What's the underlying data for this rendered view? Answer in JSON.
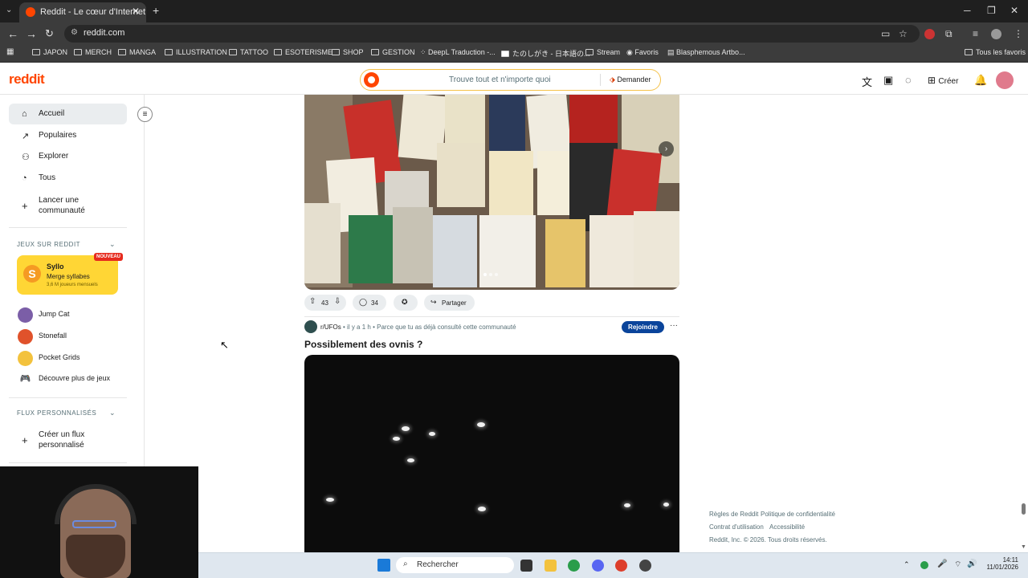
{
  "browser": {
    "tab_title": "Reddit - Le cœur d'Internet",
    "url": "reddit.com",
    "bookmarks": [
      "JAPON",
      "MERCH",
      "MANGA",
      "ILLUSTRATION",
      "TATTOO",
      "ESOTERISME",
      "SHOP",
      "GESTION",
      "DeepL Traduction -...",
      "たのしがき - 日本語の...",
      "Stream",
      "Favoris",
      "Blasphemous Artbo...",
      "Tous les favoris"
    ]
  },
  "header": {
    "logo": "reddit",
    "search_placeholder": "Trouve tout et n'importe quoi",
    "ask_label": "Demander",
    "create_label": "Créer"
  },
  "sidebar": {
    "nav": [
      {
        "label": "Accueil",
        "icon": "home-icon"
      },
      {
        "label": "Populaires",
        "icon": "popular-icon"
      },
      {
        "label": "Explorer",
        "icon": "explore-icon"
      },
      {
        "label": "Tous",
        "icon": "all-icon"
      }
    ],
    "create_community": "Lancer une communauté",
    "games_section": "JEUX SUR REDDIT",
    "featured_game": {
      "name": "Syllo",
      "tagline": "Merge syllabes",
      "players": "3,6 M joueurs mensuels",
      "badge": "NOUVEAU"
    },
    "games": [
      "Jump Cat",
      "Stonefall",
      "Pocket Grids"
    ],
    "more_games": "Découvre plus de jeux",
    "feeds_section": "FLUX PERSONNALISÉS",
    "create_feed": "Créer un flux personnalisé"
  },
  "post1": {
    "votes": "43",
    "comments": "34",
    "share_label": "Partager"
  },
  "post2": {
    "subreddit": "r/UFOs",
    "time": "il y a 1 h",
    "reason": "Parce que tu as déjà consulté cette communauté",
    "join_label": "Rejoindre",
    "title": "Possiblement des ovnis ?"
  },
  "footer": {
    "rules": "Règles de Reddit",
    "privacy": "Politique de confidentialité",
    "terms": "Contrat d'utilisation",
    "accessibility": "Accessibilité",
    "copyright": "Reddit, Inc. © 2026. Tous droits réservés."
  },
  "taskbar": {
    "search": "Rechercher",
    "time": "14:11",
    "date": "11/01/2026"
  },
  "colors": {
    "reddit_orange": "#ff4500",
    "join_blue": "#0a449b",
    "syllo_yellow": "#ffd635"
  }
}
